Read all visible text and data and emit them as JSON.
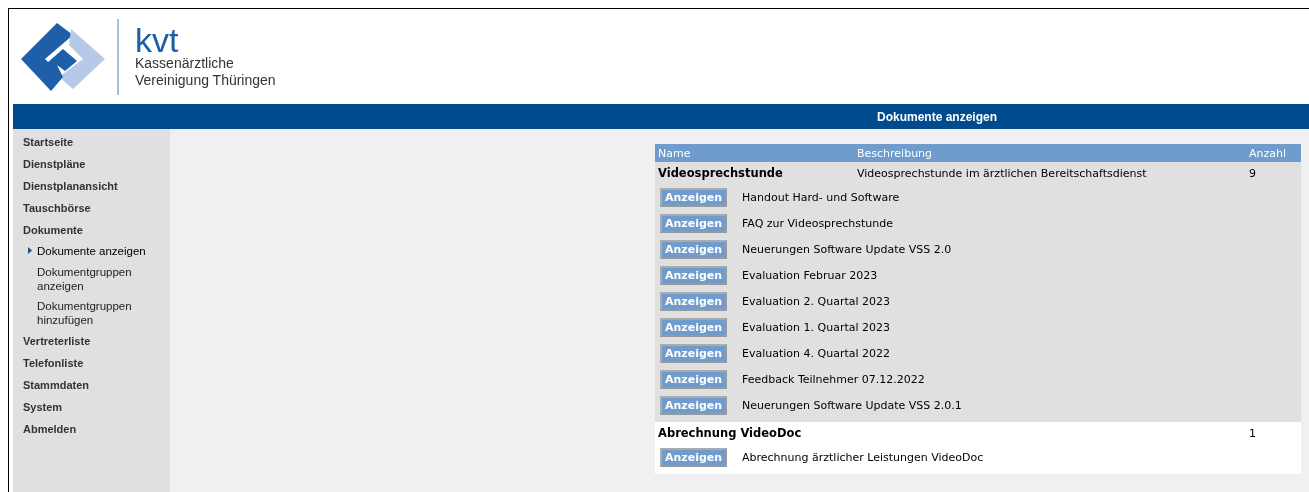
{
  "logo": {
    "abbreviation": "kvt",
    "name_lines": [
      "Kassenärztliche",
      "Vereinigung Thüringen"
    ]
  },
  "page_title": "Dokumente anzeigen",
  "sidebar": {
    "items": [
      {
        "label": "Startseite",
        "selected": false
      },
      {
        "label": "Dienstpläne",
        "selected": false
      },
      {
        "label": "Dienstplanansicht",
        "selected": false
      },
      {
        "label": "Tauschbörse",
        "selected": false
      },
      {
        "label": "Dokumente",
        "selected": false,
        "children": [
          {
            "label": "Dokumente anzeigen",
            "selected": true
          },
          {
            "label": "Dokumentgruppen anzeigen",
            "selected": false
          },
          {
            "label": "Dokumentgruppen hinzufügen",
            "selected": false
          }
        ]
      },
      {
        "label": "Vertreterliste",
        "selected": false
      },
      {
        "label": "Telefonliste",
        "selected": false
      },
      {
        "label": "Stammdaten",
        "selected": false
      },
      {
        "label": "System",
        "selected": false
      },
      {
        "label": "Abmelden",
        "selected": false
      }
    ]
  },
  "table": {
    "columns": [
      "Name",
      "Beschreibung",
      "Anzahl"
    ],
    "groups": [
      {
        "name": "Videosprechstunde",
        "description": "Videosprechstunde im ärztlichen Bereitschaftsdienst",
        "count": "9",
        "documents": [
          {
            "button": "Anzeigen",
            "title": "Handout Hard- und Software"
          },
          {
            "button": "Anzeigen",
            "title": "FAQ zur Videosprechstunde"
          },
          {
            "button": "Anzeigen",
            "title": "Neuerungen Software Update VSS 2.0"
          },
          {
            "button": "Anzeigen",
            "title": "Evaluation Februar 2023"
          },
          {
            "button": "Anzeigen",
            "title": "Evaluation 2. Quartal 2023"
          },
          {
            "button": "Anzeigen",
            "title": "Evaluation 1. Quartal 2023"
          },
          {
            "button": "Anzeigen",
            "title": "Evaluation 4. Quartal 2022"
          },
          {
            "button": "Anzeigen",
            "title": "Feedback Teilnehmer 07.12.2022"
          },
          {
            "button": "Anzeigen",
            "title": "Neuerungen Software Update VSS 2.0.1"
          }
        ]
      },
      {
        "name": "Abrechnung VideoDoc",
        "count": "1",
        "documents": [
          {
            "button": "Anzeigen",
            "title": "Abrechnung ärztlicher Leistungen VideoDoc"
          }
        ]
      }
    ]
  }
}
